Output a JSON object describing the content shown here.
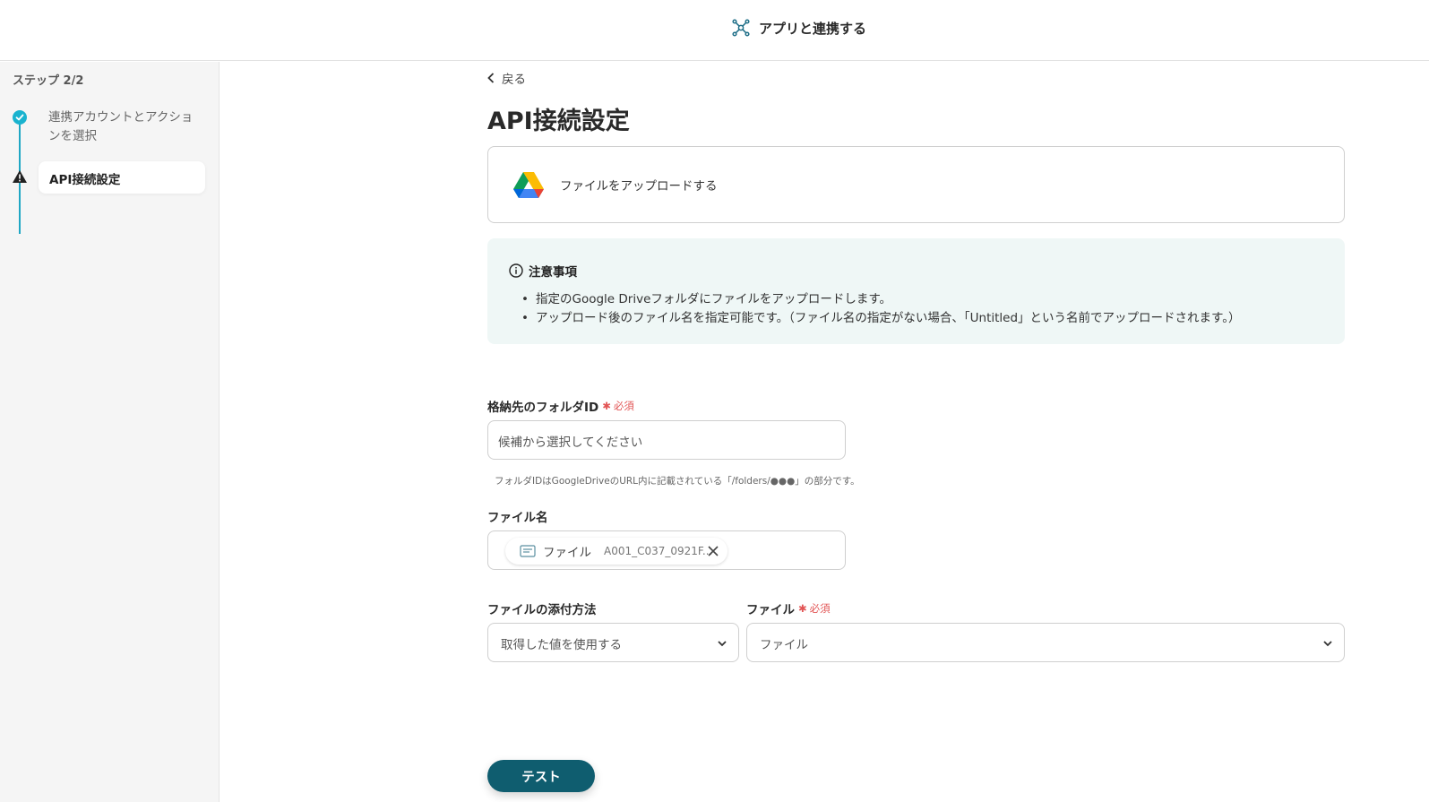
{
  "header": {
    "title": "アプリと連携する"
  },
  "sidebar": {
    "step_count": "ステップ 2/2",
    "steps": [
      {
        "label": "連携アカウントとアクションを選択",
        "status": "done"
      },
      {
        "label": "API接続設定",
        "status": "warning"
      }
    ]
  },
  "main": {
    "back_label": "戻る",
    "title": "API接続設定",
    "app_card": {
      "icon": "google-drive-icon",
      "label": "ファイルをアップロードする"
    },
    "notice": {
      "title": "注意事項",
      "items": [
        "指定のGoogle Driveフォルダにファイルをアップロードします。",
        "アップロード後のファイル名を指定可能です。（ファイル名の指定がない場合、「Untitled」という名前でアップロードされます。）"
      ]
    },
    "fields": {
      "folder": {
        "label": "格納先のフォルダID",
        "required": "必須",
        "placeholder": "候補から選択してください",
        "hint": "フォルダIDはGoogleDriveのURL内に記載されている「/folders/●●●」の部分です。"
      },
      "filename": {
        "label": "ファイル名",
        "chip_label": "ファイル",
        "chip_value": "A001_C037_0921F..."
      },
      "attach_method": {
        "label": "ファイルの添付方法",
        "value": "取得した値を使用する"
      },
      "file": {
        "label": "ファイル",
        "required": "必須",
        "value": "ファイル"
      }
    },
    "test_button": "テスト"
  },
  "colors": {
    "accent": "#19b3cf",
    "primary_button": "#0f5d6f",
    "required": "#e25555",
    "notice_bg": "#eff7f6"
  }
}
